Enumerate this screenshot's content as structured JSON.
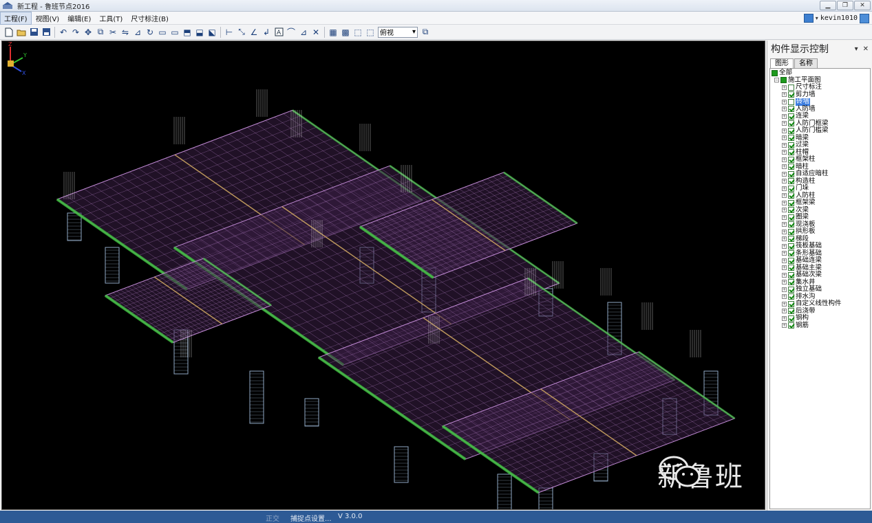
{
  "window": {
    "title": "新工程 - 鲁班节点2016",
    "buttons": {
      "minimize": "▁",
      "restore": "❐",
      "close": "✕"
    }
  },
  "menu": {
    "items": [
      {
        "label": "工程(F)",
        "active": true
      },
      {
        "label": "视图(V)"
      },
      {
        "label": "编辑(E)"
      },
      {
        "label": "工具(T)"
      },
      {
        "label": "尺寸标注(B)"
      }
    ]
  },
  "user": {
    "name": "kevin1010",
    "dropdown": "▾"
  },
  "toolbar": {
    "view_select": "俯视",
    "view_select_arrow": "▾",
    "icons": [
      "new-file-icon",
      "open-folder-icon",
      "save-icon",
      "save-as-icon",
      "undo-icon",
      "redo-icon",
      "move-icon",
      "copy-icon",
      "cut-icon",
      "mirror-icon",
      "offset-icon",
      "rotate-icon",
      "array-icon",
      "trim-icon",
      "extend-icon",
      "break-icon",
      "join-icon",
      "dimension-icon",
      "aligned-dim-icon",
      "angle-dim-icon",
      "leader-icon",
      "text-icon",
      "arc-icon",
      "measure-icon",
      "tools-icon",
      "view-icon-1",
      "view-icon-2",
      "view-icon-3",
      "view-icon-4",
      "pan-icon"
    ]
  },
  "panel": {
    "title": "构件显示控制",
    "pin": "▾",
    "close": "✕",
    "tabs": [
      "图形",
      "名称"
    ],
    "root": "全部",
    "group": "施工平面图",
    "items": [
      {
        "label": "尺寸标注",
        "checked": false
      },
      {
        "label": "剪力墙",
        "checked": true
      },
      {
        "label": "砖墙",
        "checked": false,
        "selected": true
      },
      {
        "label": "人防墙",
        "checked": true
      },
      {
        "label": "连梁",
        "checked": true
      },
      {
        "label": "人防门框梁",
        "checked": true
      },
      {
        "label": "人防门槛梁",
        "checked": true
      },
      {
        "label": "暗梁",
        "checked": true
      },
      {
        "label": "过梁",
        "checked": true
      },
      {
        "label": "柱帽",
        "checked": true
      },
      {
        "label": "框架柱",
        "checked": true
      },
      {
        "label": "暗柱",
        "checked": true
      },
      {
        "label": "自适应暗柱",
        "checked": true
      },
      {
        "label": "构造柱",
        "checked": true
      },
      {
        "label": "门垛",
        "checked": true
      },
      {
        "label": "人防柱",
        "checked": true
      },
      {
        "label": "框架梁",
        "checked": true
      },
      {
        "label": "次梁",
        "checked": true
      },
      {
        "label": "圈梁",
        "checked": true
      },
      {
        "label": "现浇板",
        "checked": true
      },
      {
        "label": "拱形板",
        "checked": true
      },
      {
        "label": "梯段",
        "checked": true
      },
      {
        "label": "筏板基础",
        "checked": true
      },
      {
        "label": "条形基础",
        "checked": true
      },
      {
        "label": "基础连梁",
        "checked": true
      },
      {
        "label": "基础主梁",
        "checked": true
      },
      {
        "label": "基础次梁",
        "checked": true
      },
      {
        "label": "集水井",
        "checked": true
      },
      {
        "label": "独立基础",
        "checked": true
      },
      {
        "label": "排水沟",
        "checked": true
      },
      {
        "label": "自定义线性构件",
        "checked": true
      },
      {
        "label": "后浇带",
        "checked": true
      },
      {
        "label": "钢构",
        "checked": true
      },
      {
        "label": "钢筋",
        "checked": true
      }
    ]
  },
  "viewport": {
    "axes": {
      "x": "X",
      "y": "Y",
      "z": "Z"
    },
    "colors": {
      "slab": "#c28bd6",
      "beam": "#3fbf3f",
      "column": "#a9c7e8",
      "stirrup": "#d8b060"
    }
  },
  "watermark": {
    "text": "新鲁班"
  },
  "statusbar": {
    "ortho": "正交",
    "snap": "捕捉点设置...",
    "version": "V 3.0.0"
  }
}
